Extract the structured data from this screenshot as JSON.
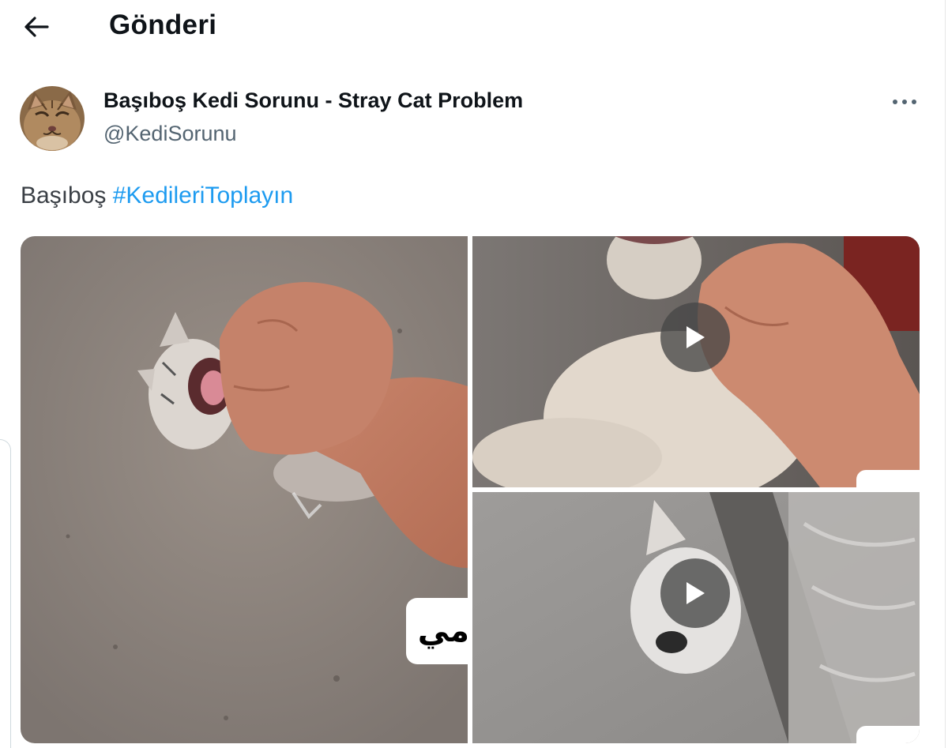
{
  "header": {
    "title": "Gönderi",
    "back_icon": "arrow-left-icon"
  },
  "tweet": {
    "author": {
      "display_name": "Başıboş Kedi Sorunu - Stray Cat Problem",
      "handle": "@KediSorunu",
      "avatar": "cat-face-avatar"
    },
    "more_icon": "more-horizontal-icon",
    "text_plain": "Başıboş ",
    "hashtag": "#KedileriToplayın",
    "media": {
      "count": 3,
      "items": [
        {
          "kind": "image",
          "description_icon": "photo-hand-cat",
          "overlay_text": "مي"
        },
        {
          "kind": "video",
          "play_icon": "play-icon"
        },
        {
          "kind": "video",
          "play_icon": "play-icon"
        }
      ]
    }
  },
  "colors": {
    "accent": "#1d9bf0",
    "text_primary": "#0f1419",
    "text_secondary": "#536471"
  }
}
